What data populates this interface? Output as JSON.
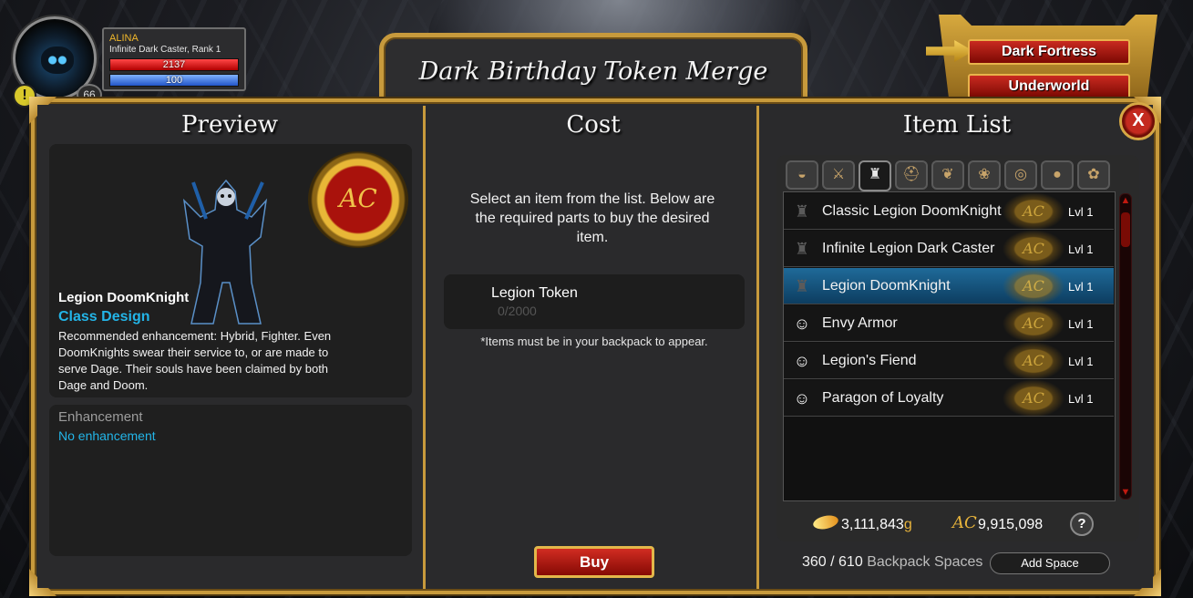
{
  "player": {
    "name": "ALINA",
    "class_rank": "Infinite Dark Caster, Rank 1",
    "hp": "2137",
    "mp": "100",
    "level": "66",
    "alert": "!"
  },
  "map_buttons": {
    "primary": "Dark Fortress",
    "secondary": "Underworld"
  },
  "window_title": "Dark Birthday Token Merge",
  "preview": {
    "heading": "Preview",
    "currency_icon": "AC",
    "item_name": "Legion DoomKnight",
    "item_type": "Class Design",
    "description": "Recommended enhancement: Hybrid, Fighter. Even DoomKnights swear their service to, or are made to serve Dage. Their souls have been claimed by both Dage and Doom.",
    "enhancement_heading": "Enhancement",
    "enhancement_value": "No enhancement"
  },
  "cost": {
    "heading": "Cost",
    "message": "Select an item from the list. Below are the required parts to buy the desired item.",
    "requirement_name": "Legion Token",
    "requirement_qty": "0/2000",
    "note": "*Items must be in your backpack to appear.",
    "buy_label": "Buy"
  },
  "item_list": {
    "heading": "Item List",
    "close_label": "X",
    "tabs": [
      {
        "icon": "helm-bag-icon",
        "glyph": "◒"
      },
      {
        "icon": "sword-icon",
        "glyph": "⚔"
      },
      {
        "icon": "armor-icon",
        "glyph": "♜"
      },
      {
        "icon": "helmet-icon",
        "glyph": "⛑"
      },
      {
        "icon": "cape-icon",
        "glyph": "❦"
      },
      {
        "icon": "pet-icon",
        "glyph": "❀"
      },
      {
        "icon": "amulet-icon",
        "glyph": "◎"
      },
      {
        "icon": "sack-icon",
        "glyph": "●"
      },
      {
        "icon": "drumstick-icon",
        "glyph": "✿"
      }
    ],
    "items": [
      {
        "label": "Classic Legion DoomKnight",
        "level": "Lvl 1",
        "icon": "armor-icon",
        "glyph": "♜",
        "currency": "AC"
      },
      {
        "label": "Infinite Legion Dark Caster",
        "level": "Lvl 1",
        "icon": "armor-icon",
        "glyph": "♜",
        "currency": "AC"
      },
      {
        "label": "Legion DoomKnight",
        "level": "Lvl 1",
        "icon": "armor-icon",
        "glyph": "♜",
        "currency": "AC"
      },
      {
        "label": "Envy Armor",
        "level": "Lvl 1",
        "icon": "mask-icon",
        "glyph": "☺",
        "currency": "AC"
      },
      {
        "label": "Legion's Fiend",
        "level": "Lvl 1",
        "icon": "mask-icon",
        "glyph": "☺",
        "currency": "AC"
      },
      {
        "label": "Paragon of Loyalty",
        "level": "Lvl 1",
        "icon": "mask-icon",
        "glyph": "☺",
        "currency": "AC"
      }
    ],
    "gold": "3,111,843",
    "gold_unit": "g",
    "ac_symbol": "AC",
    "ac": "9,915,098",
    "help": "?",
    "backpack_used": "360 / 610",
    "backpack_label": "Backpack Spaces",
    "add_space_label": "Add Space"
  }
}
